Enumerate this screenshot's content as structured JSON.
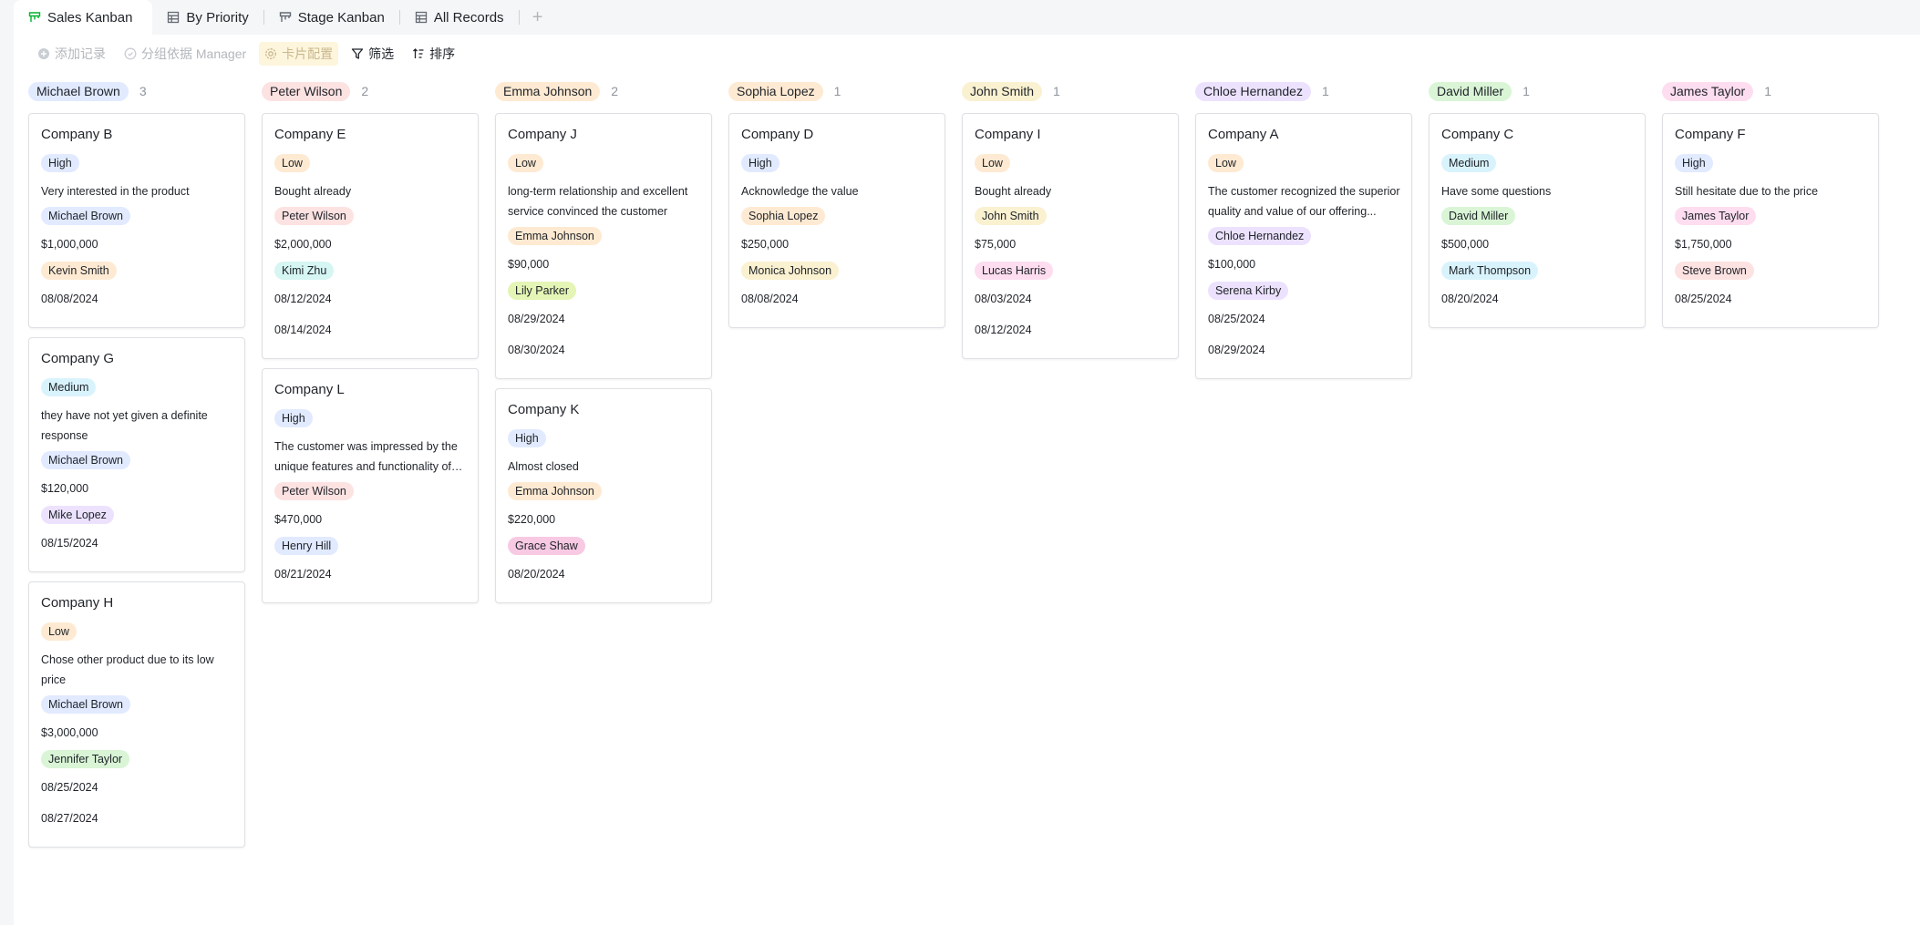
{
  "tabs": [
    {
      "label": "Sales Kanban",
      "icon": "kanban-icon",
      "active": true
    },
    {
      "label": "By Priority",
      "icon": "grid-icon",
      "active": false
    },
    {
      "label": "Stage Kanban",
      "icon": "kanban-icon",
      "active": false
    },
    {
      "label": "All Records",
      "icon": "grid-icon",
      "active": false
    }
  ],
  "tab_add_label": "+",
  "toolbar": {
    "add_record": "添加记录",
    "group_by": "分组依据 Manager",
    "card_config": "卡片配置",
    "filter": "筛选",
    "sort": "排序"
  },
  "colors": {
    "accent": "#00b42a",
    "chip_blue": "#e1eaff",
    "chip_orange": "#feead2",
    "chip_red": "#fde2e2"
  },
  "columns": [
    {
      "name": "Michael Brown",
      "color": "c-blue",
      "count": "3",
      "cards": [
        {
          "title": "Company B",
          "priority": {
            "label": "High",
            "color": "c-blue"
          },
          "note": "Very interested in the product",
          "manager": {
            "label": "Michael Brown",
            "color": "c-blue"
          },
          "amount": "$1,000,000",
          "contact": {
            "label": "Kevin Smith",
            "color": "c-orange"
          },
          "dates": [
            "08/08/2024"
          ]
        },
        {
          "title": "Company G",
          "priority": {
            "label": "Medium",
            "color": "c-lightblue"
          },
          "note": "they have not yet given a definite response",
          "manager": {
            "label": "Michael Brown",
            "color": "c-blue"
          },
          "amount": "$120,000",
          "contact": {
            "label": "Mike Lopez",
            "color": "c-purple"
          },
          "dates": [
            "08/15/2024"
          ]
        },
        {
          "title": "Company H",
          "priority": {
            "label": "Low",
            "color": "c-orange"
          },
          "note": "Chose other product due to its low price",
          "manager": {
            "label": "Michael Brown",
            "color": "c-blue"
          },
          "amount": "$3,000,000",
          "contact": {
            "label": "Jennifer Taylor",
            "color": "c-green"
          },
          "dates": [
            "08/25/2024",
            "08/27/2024"
          ]
        }
      ]
    },
    {
      "name": "Peter Wilson",
      "color": "c-red",
      "count": "2",
      "cards": [
        {
          "title": "Company E",
          "priority": {
            "label": "Low",
            "color": "c-orange"
          },
          "note": "Bought already",
          "manager": {
            "label": "Peter Wilson",
            "color": "c-red"
          },
          "amount": "$2,000,000",
          "contact": {
            "label": "Kimi Zhu",
            "color": "c-teal"
          },
          "dates": [
            "08/12/2024",
            "08/14/2024"
          ]
        },
        {
          "title": "Company L",
          "priority": {
            "label": "High",
            "color": "c-blue"
          },
          "note": "The customer was impressed by the unique features and functionality of t...",
          "manager": {
            "label": "Peter Wilson",
            "color": "c-red"
          },
          "amount": "$470,000",
          "contact": {
            "label": "Henry Hill",
            "color": "c-blue"
          },
          "dates": [
            "08/21/2024"
          ]
        }
      ]
    },
    {
      "name": "Emma Johnson",
      "color": "c-orange",
      "count": "2",
      "cards": [
        {
          "title": "Company J",
          "priority": {
            "label": "Low",
            "color": "c-orange"
          },
          "note": "long-term relationship and excellent service convinced the customer",
          "manager": {
            "label": "Emma Johnson",
            "color": "c-orange"
          },
          "amount": "$90,000",
          "contact": {
            "label": "Lily Parker",
            "color": "c-lime"
          },
          "dates": [
            "08/29/2024",
            "08/30/2024"
          ]
        },
        {
          "title": "Company K",
          "priority": {
            "label": "High",
            "color": "c-blue"
          },
          "note": "Almost closed",
          "manager": {
            "label": "Emma Johnson",
            "color": "c-orange"
          },
          "amount": "$220,000",
          "contact": {
            "label": "Grace Shaw",
            "color": "c-magenta"
          },
          "dates": [
            "08/20/2024"
          ]
        }
      ]
    },
    {
      "name": "Sophia Lopez",
      "color": "c-orange",
      "count": "1",
      "cards": [
        {
          "title": "Company D",
          "priority": {
            "label": "High",
            "color": "c-blue"
          },
          "note": "Acknowledge the value",
          "manager": {
            "label": "Sophia Lopez",
            "color": "c-orange"
          },
          "amount": "$250,000",
          "contact": {
            "label": "Monica Johnson",
            "color": "c-yellow"
          },
          "dates": [
            "08/08/2024"
          ]
        }
      ]
    },
    {
      "name": "John Smith",
      "color": "c-yellow",
      "count": "1",
      "cards": [
        {
          "title": "Company I",
          "priority": {
            "label": "Low",
            "color": "c-orange"
          },
          "note": "Bought already",
          "manager": {
            "label": "John Smith",
            "color": "c-yellow"
          },
          "amount": "$75,000",
          "contact": {
            "label": "Lucas Harris",
            "color": "c-pink"
          },
          "dates": [
            "08/03/2024",
            "08/12/2024"
          ]
        }
      ]
    },
    {
      "name": "Chloe Hernandez",
      "color": "c-purple",
      "count": "1",
      "cards": [
        {
          "title": "Company A",
          "priority": {
            "label": "Low",
            "color": "c-orange"
          },
          "note": "The customer recognized the superior quality and value of our offering...",
          "manager": {
            "label": "Chloe Hernandez",
            "color": "c-purple"
          },
          "amount": "$100,000",
          "contact": {
            "label": "Serena Kirby",
            "color": "c-purple"
          },
          "dates": [
            "08/25/2024",
            "08/29/2024"
          ]
        }
      ]
    },
    {
      "name": "David Miller",
      "color": "c-green",
      "count": "1",
      "cards": [
        {
          "title": "Company C",
          "priority": {
            "label": "Medium",
            "color": "c-lightblue"
          },
          "note": "Have some questions",
          "manager": {
            "label": "David Miller",
            "color": "c-green"
          },
          "amount": "$500,000",
          "contact": {
            "label": "Mark Thompson",
            "color": "c-lightblue"
          },
          "dates": [
            "08/20/2024"
          ]
        }
      ]
    },
    {
      "name": "James Taylor",
      "color": "c-pink",
      "count": "1",
      "cards": [
        {
          "title": "Company F",
          "priority": {
            "label": "High",
            "color": "c-blue"
          },
          "note": "Still hesitate due to the price",
          "manager": {
            "label": "James Taylor",
            "color": "c-pink"
          },
          "amount": "$1,750,000",
          "contact": {
            "label": "Steve Brown",
            "color": "c-red"
          },
          "dates": [
            "08/25/2024"
          ]
        }
      ]
    }
  ]
}
